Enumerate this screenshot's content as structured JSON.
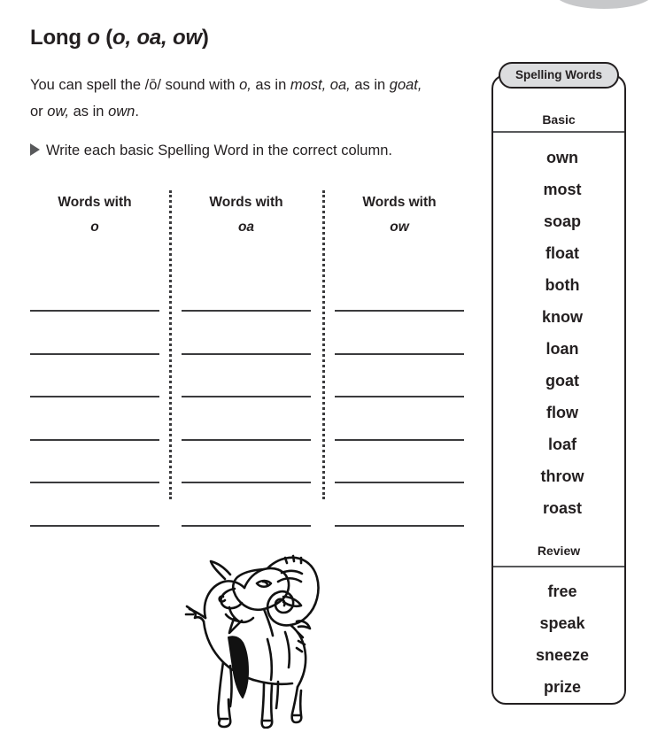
{
  "page_title": {
    "plain_1": "Long ",
    "italic_1": "o",
    "plain_2": " (",
    "italic_2": "o, oa, ow",
    "plain_3": ")",
    "full": "Long o (o, oa, ow)"
  },
  "intro": {
    "p1": "You can spell the /ō/ sound with ",
    "i1": "o,",
    "p2": " as in ",
    "i2": "most,",
    "p3": " ",
    "i3": "oa,",
    "p4": " as in ",
    "i4": "goat,",
    "p5": " or ",
    "i5": "ow,",
    "p6": " as in ",
    "i6": "own",
    "p7": "."
  },
  "instruction": {
    "bullet_icon": "triangle-right-icon",
    "text": "Write each basic Spelling Word in the correct column."
  },
  "sort_columns": [
    {
      "heading": "Words with",
      "pattern": "o",
      "line_count": 6
    },
    {
      "heading": "Words with",
      "pattern": "oa",
      "line_count": 6
    },
    {
      "heading": "Words with",
      "pattern": "ow",
      "line_count": 6
    }
  ],
  "spelling_words_box": {
    "pill_label": "Spelling Words",
    "basic_label": "Basic",
    "basic_words": [
      "own",
      "most",
      "soap",
      "float",
      "both",
      "know",
      "loan",
      "goat",
      "flow",
      "loaf",
      "throw",
      "roast"
    ],
    "review_label": "Review",
    "review_words": [
      "free",
      "speak",
      "sneeze",
      "prize"
    ]
  },
  "illustration": {
    "name": "ram-illustration",
    "description": "Line drawing of a ram (bighorn sheep) with large curled horns"
  },
  "colors": {
    "text": "#231f20",
    "rule": "#3b3b3d",
    "pill_fill": "#dcdddf",
    "bullet": "#58595b",
    "corner_arc": "#c7c8ca"
  }
}
